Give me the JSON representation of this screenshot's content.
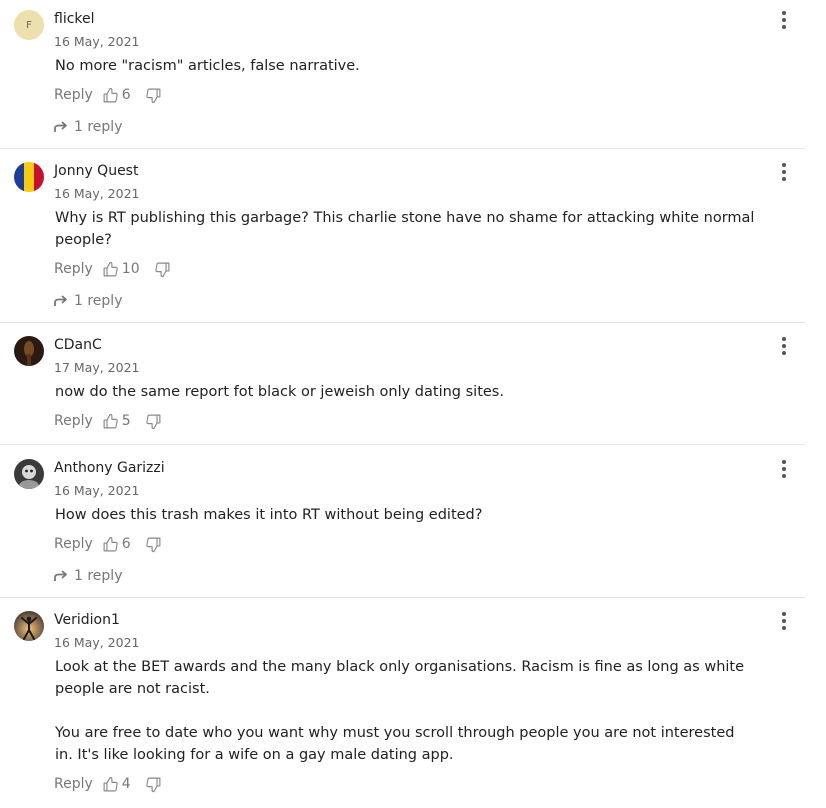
{
  "labels": {
    "reply": "Reply"
  },
  "comments": [
    {
      "author": "flickel",
      "avatar_initial": "F",
      "date": "16 May, 2021",
      "text": [
        "No more \"racism\" articles, false narrative."
      ],
      "likes": "6",
      "replies": "1 reply"
    },
    {
      "author": "Jonny Quest",
      "date": "16 May, 2021",
      "text": [
        "Why is RT publishing this garbage? This charlie stone have no shame for attacking white normal people?"
      ],
      "likes": "10",
      "replies": "1 reply"
    },
    {
      "author": "CDanC",
      "date": "17 May, 2021",
      "text": [
        "now do the same report fot black or jeweish only dating sites."
      ],
      "likes": "5"
    },
    {
      "author": "Anthony Garizzi",
      "date": "16 May, 2021",
      "text": [
        "How does this trash makes it into RT without being edited?"
      ],
      "likes": "6",
      "replies": "1 reply"
    },
    {
      "author": "Veridion1",
      "date": "16 May, 2021",
      "text": [
        "Look at the BET awards and the many black only organisations. Racism is fine as long as white people are not racist.",
        "You are free to date who you want why must you scroll through people you are not interested in. It's like looking for a wife on a gay male dating app."
      ],
      "likes": "4"
    }
  ]
}
